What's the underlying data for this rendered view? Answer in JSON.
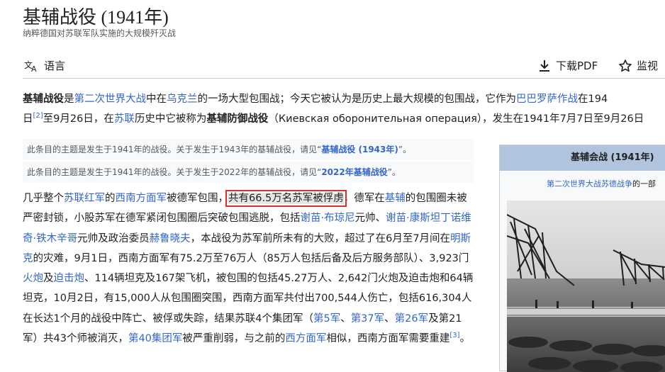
{
  "title": "基辅战役 (1941年)",
  "subtitle": "纳粹德国对苏联军队实施的大规模歼灭战",
  "toolbar": {
    "language": "语言",
    "download_pdf": "下载PDF",
    "watch": "监视"
  },
  "lead": {
    "l1": [
      "基辅战役",
      "是",
      "第二次世界大战",
      "中在",
      "乌克兰",
      "的一场大型包围战；今天它被认为是历史上最大规模的包围战，它作为",
      "巴巴罗萨作战",
      "在194"
    ],
    "l2": [
      "日",
      "[2]",
      "至9月26日，在",
      "苏联",
      "历史中它被称为",
      "基辅防御战役",
      "（Киевская оборонительная операция），发生在1941年7月7日至9月26日"
    ]
  },
  "hatnotes": [
    {
      "text": "此条目的主题是发生于1941年的战役。关于发生于1943年的基辅战役，请见“",
      "link": "基辅战役 (1943年)",
      "end": "”。"
    },
    {
      "text": "此条目的主题是发生于1941年的战役。关于发生于2022年的基辅战役，请见“",
      "link": "2022年基辅战役",
      "end": "”。"
    }
  ],
  "body": {
    "s01": "几乎整个",
    "k01": "苏联红军",
    "s02": "的",
    "k02": "西南方面军",
    "s03": "被德军包围，",
    "hl": "共有66.5万名苏军被俘虏",
    "s04": "，德军在",
    "k03": "基辅",
    "s05": "的包围圈未被严密封锁，小股苏军在德军紧闭包围圈后突破包围逃脱，包括",
    "k04": "谢苗·布琼尼",
    "s06": "元帅、",
    "k05": "谢苗·康斯坦丁诺维奇·铁木辛哥",
    "s07": "元帅及政治委员",
    "k06": "赫鲁晓夫",
    "s08": "，本战役为苏军前所未有的大败，超过了在6月至7月间在",
    "k07": "明斯克",
    "s09": "的灾难，9月1日，西南方面军有75.2万至76万人（85万人包括后备及后方服务部队）、3,923门",
    "k08": "火炮",
    "s10": "及",
    "k09": "迫击炮",
    "s11": "、114辆坦克及167架飞机，被包围的包括45.27万人、2,642门火炮及迫击炮和64辆坦克，10月2日，有15,000人从包围圈突围，西南方面军共付出700,544人伤亡，包括616,304人在长达1个月的战役中阵亡、被俘或失踪，结果苏联4个集团军（",
    "k10": "第5军",
    "s12": "、",
    "k11": "第37军",
    "s13": "、",
    "k12": "第26军",
    "s14": "及第21军）共43个师被消灭，",
    "k13": "第40集团军",
    "s15": "被严重削弱，与之前的",
    "k14": "西方面军",
    "s16": "相似，西南方面军需要重建",
    "ref": "[3]",
    "s17": "。"
  },
  "infobox": {
    "header": "基辅会战 (1941年)",
    "sub_link": "第二次世界大战苏德战争",
    "sub_text": "的一部"
  }
}
